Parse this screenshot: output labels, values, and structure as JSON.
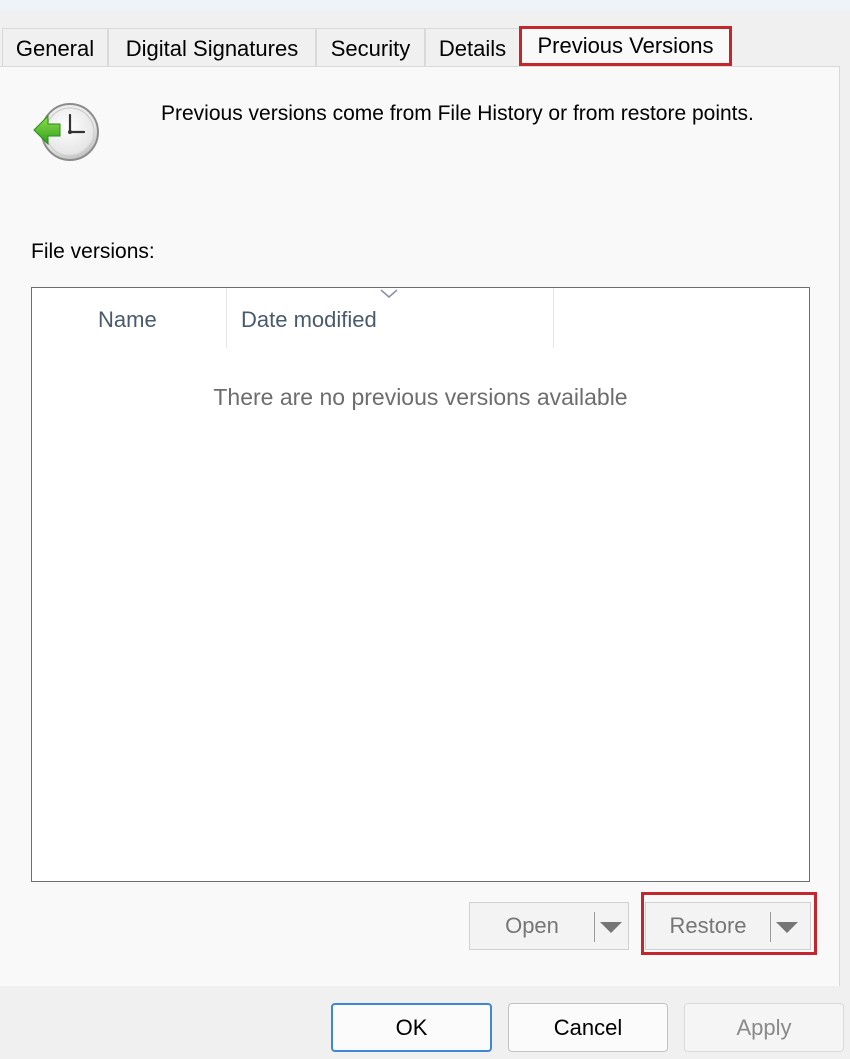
{
  "tabs": [
    {
      "label": "General"
    },
    {
      "label": "Digital Signatures"
    },
    {
      "label": "Security"
    },
    {
      "label": "Details"
    },
    {
      "label": "Previous Versions",
      "active": true
    }
  ],
  "intro_text": "Previous versions come from File History or from restore points.",
  "file_versions": {
    "label": "File versions:",
    "columns": [
      "Name",
      "Date modified"
    ],
    "empty_message": "There are no previous versions available"
  },
  "actions": {
    "open_label": "Open",
    "restore_label": "Restore"
  },
  "footer": {
    "ok_label": "OK",
    "cancel_label": "Cancel",
    "apply_label": "Apply"
  },
  "colors": {
    "highlight": "#c4262e",
    "default_button_border": "#3f86d4"
  },
  "icons": {
    "header": "history-clock-icon",
    "sort": "sort-descending-icon",
    "dropdown": "dropdown-arrow-icon"
  }
}
